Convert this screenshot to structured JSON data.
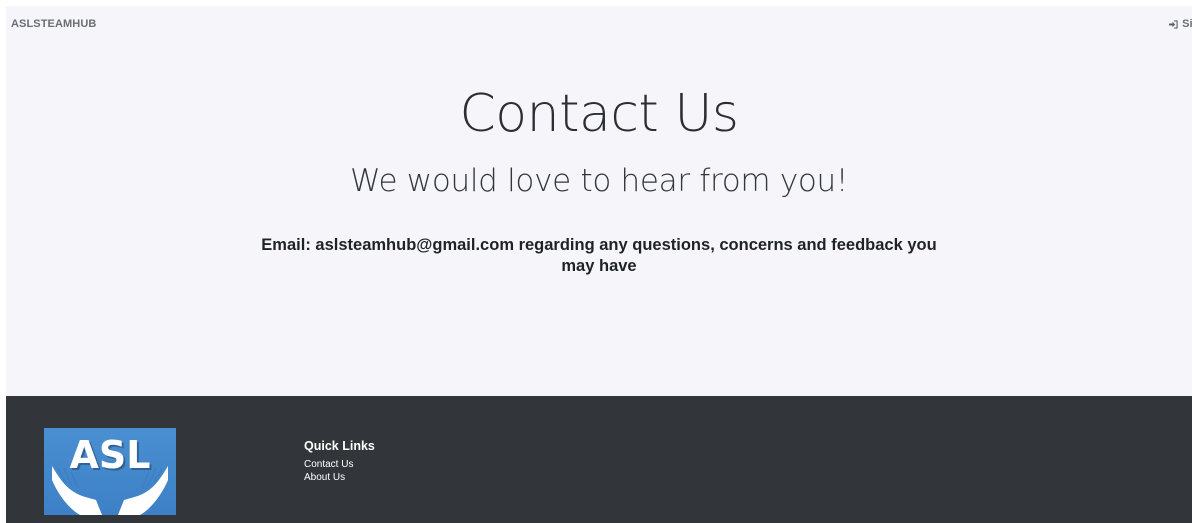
{
  "header": {
    "brand": "ASLSTEAMHUB",
    "signin_label": "Sign",
    "signin_icon": "sign-in-icon"
  },
  "hero": {
    "title": "Contact Us",
    "subtitle": "We would love to hear from you!"
  },
  "contact": {
    "email_label": "Email:",
    "message": "aslsteamhub@gmail.com regarding any questions, concerns and feedback you may have"
  },
  "footer": {
    "logo_text": "ASL",
    "quick_links_title": "Quick Links",
    "links": [
      {
        "label": "Contact Us"
      },
      {
        "label": "About Us"
      }
    ]
  },
  "colors": {
    "page_bg": "#f5f5fa",
    "footer_bg": "#32363b",
    "logo_bg": "#4a8fd1"
  }
}
